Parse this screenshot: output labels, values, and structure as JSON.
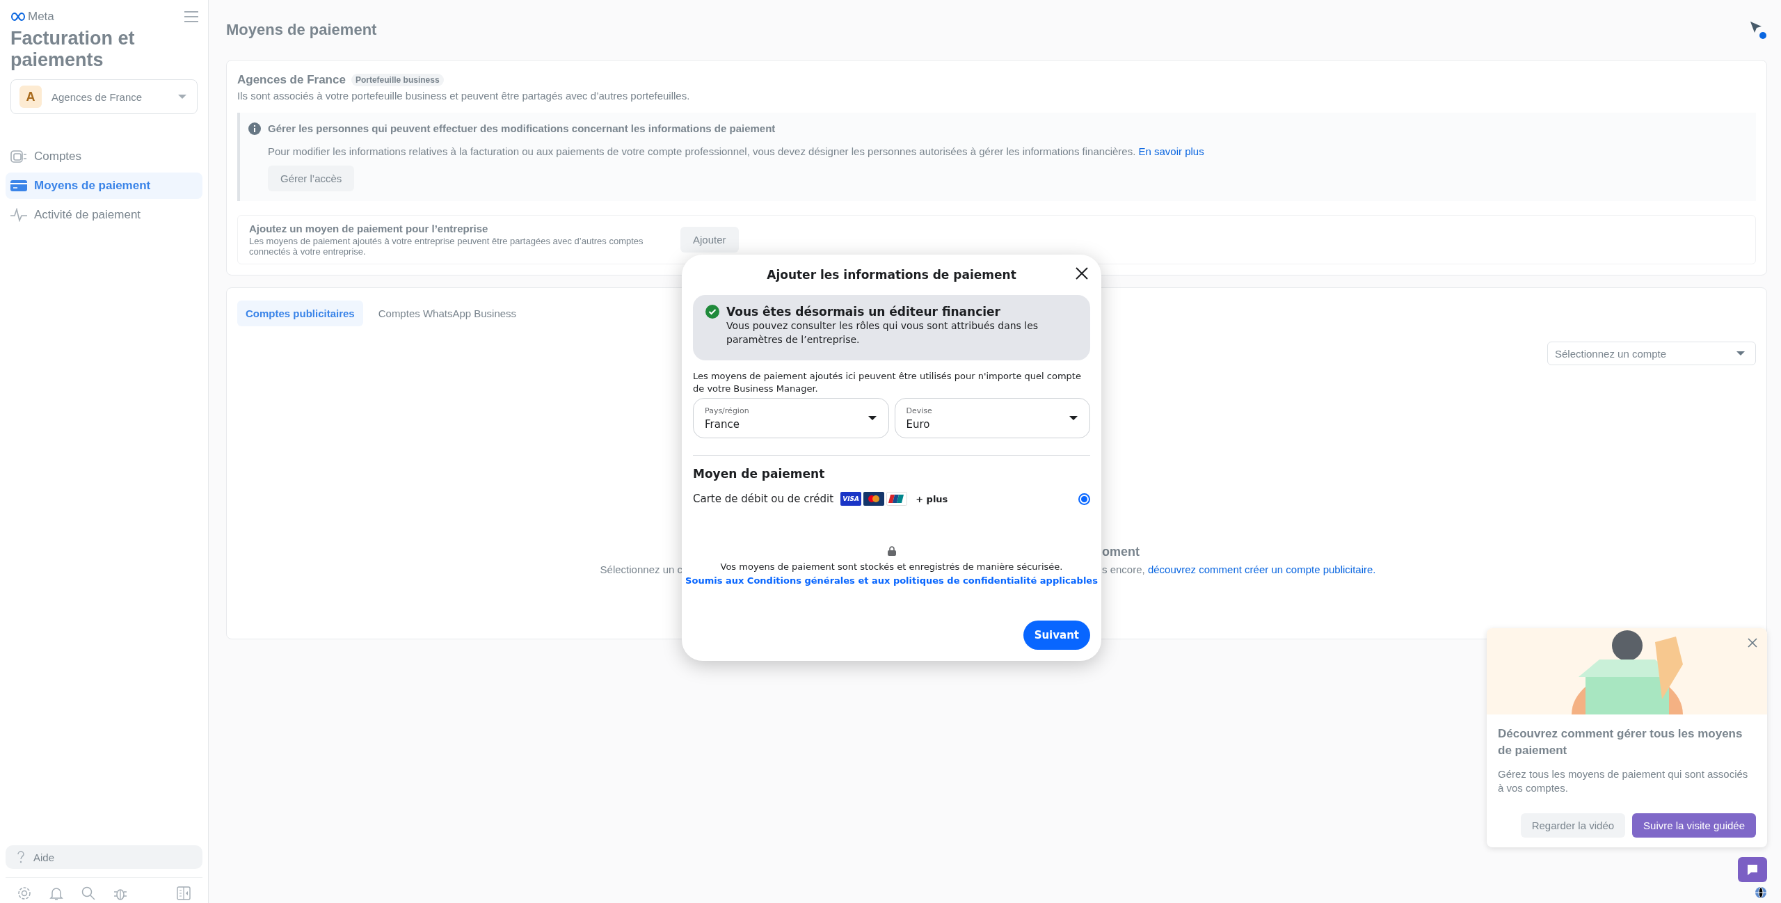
{
  "sidebar": {
    "logo": "Meta",
    "title": "Facturation et paiements",
    "account": {
      "initial": "A",
      "name": "Agences de France"
    },
    "nav": [
      {
        "label": "Comptes",
        "selected": false
      },
      {
        "label": "Moyens de paiement",
        "selected": true
      },
      {
        "label": "Activité de paiement",
        "selected": false
      }
    ],
    "help": "Aide"
  },
  "page_title": "Moyens de paiement",
  "business": {
    "name": "Agences de France",
    "badge": "Portefeuille business",
    "description": "Ils sont associés à votre portefeuille business et peuvent être partagés avec d’autres portefeuilles.",
    "notice": {
      "title": "Gérer les personnes qui peuvent effectuer des modifications concernant les informations de paiement",
      "text": "Pour modifier les informations relatives à la facturation ou aux paiements de votre compte professionnel, vous devez désigner les personnes autorisées à gérer les informations financières.",
      "link": "En savoir plus",
      "button": "Gérer l’accès"
    },
    "add": {
      "title": "Ajoutez un moyen de paiement pour l’entreprise",
      "text": "Les moyens de paiement ajoutés à votre entreprise peuvent être partagées avec d’autres comptes connectés à votre entreprise.",
      "button": "Ajouter"
    }
  },
  "accounts": {
    "tabs": [
      {
        "label": "Comptes publicitaires",
        "selected": true
      },
      {
        "label": "Comptes WhatsApp Business",
        "selected": false
      }
    ],
    "select_placeholder": "Sélectionnez un compte",
    "empty_left": "Sélectionnez un c",
    "empty_heading": "oment",
    "empty_text": "s encore,",
    "empty_link": "découvrez comment créer un compte publicitaire."
  },
  "promo": {
    "title": "Découvrez comment gérer tous les moyens de paiement",
    "text": "Gérez tous les moyens de paiement qui sont associés à vos comptes.",
    "secondary_button": "Regarder la vidéo",
    "primary_button": "Suivre la visite guidée"
  },
  "modal": {
    "title": "Ajouter les informations de paiement",
    "success": {
      "title": "Vous êtes désormais un éditeur financier",
      "text": "Vous pouvez consulter les rôles qui vous sont attribués dans les paramètres de l’entreprise."
    },
    "intro": "Les moyens de paiement ajoutés ici peuvent être utilisés pour n'importe quel compte de votre Business Manager.",
    "country": {
      "label": "Pays/région",
      "value": "France"
    },
    "currency": {
      "label": "Devise",
      "value": "Euro"
    },
    "section": "Moyen de paiement",
    "options": [
      {
        "label": "Carte de débit ou de crédit",
        "brands": [
          {
            "kind": "visa",
            "text": "VISA"
          },
          {
            "kind": "mastercard"
          },
          {
            "kind": "unionpay"
          }
        ],
        "more": "+ plus",
        "selected": true
      }
    ],
    "secure_text": "Vos moyens de paiement sont stockés et enregistrés de manière sécurisée.",
    "terms_link": "Soumis aux Conditions générales et aux politiques de confidentialité applicables",
    "next_button": "Suivant"
  }
}
